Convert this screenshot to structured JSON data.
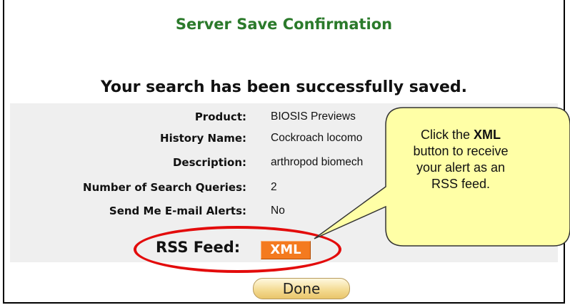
{
  "dialog": {
    "title": "Server Save Confirmation",
    "success_message": "Your search has been successfully saved."
  },
  "details": [
    {
      "label": "Product:",
      "value": "BIOSIS Previews"
    },
    {
      "label": "History Name:",
      "value": "Cockroach locomo"
    },
    {
      "label": "Description:",
      "value": "arthropod biomech"
    },
    {
      "label": "Number of Search Queries:",
      "value": "2"
    },
    {
      "label": "Send Me E-mail Alerts:",
      "value": "No"
    }
  ],
  "rss": {
    "label": "RSS Feed:",
    "button_label": "XML"
  },
  "done_button": "Done",
  "callout": {
    "line1_pre": "Click the ",
    "line1_bold": "XML",
    "line2": "button to receive",
    "line3": "your alert as an",
    "line4": "RSS feed."
  },
  "colors": {
    "title": "#2b7a2b",
    "xml_button": "#f47a1f",
    "annotation_circle": "#e30b0b",
    "callout_fill": "#ffffa6"
  }
}
